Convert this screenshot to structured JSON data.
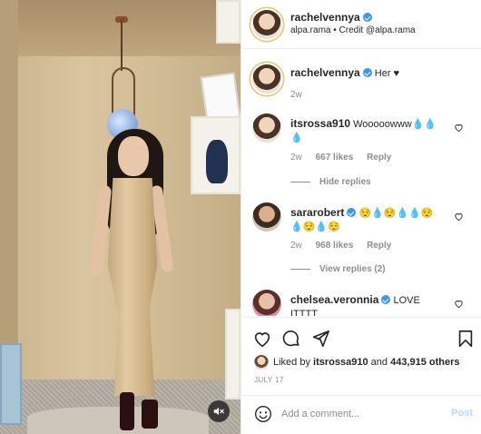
{
  "header": {
    "username": "rachelvennya",
    "verified": true,
    "subtitle": "alpa.rama • Credit @alpa.rama"
  },
  "comments": [
    {
      "username": "rachelvennya",
      "verified": true,
      "text": "Her ♥",
      "time": "2w",
      "is_caption": true
    },
    {
      "username": "itsrossa910",
      "verified": false,
      "text": "Wooooowww💧💧💧",
      "time": "2w",
      "likes": "667 likes",
      "reply_label": "Reply",
      "replies_toggle": "Hide replies"
    },
    {
      "username": "sararobert",
      "verified": true,
      "text": "😌💧😌💧💧😌💧😌💧😌",
      "time": "2w",
      "likes": "968 likes",
      "reply_label": "Reply",
      "replies_toggle": "View replies (2)"
    },
    {
      "username": "chelsea.veronnia",
      "verified": true,
      "text": "LOVE ITTTT"
    }
  ],
  "actions": {
    "icons": [
      "heart-icon",
      "comment-icon",
      "share-icon",
      "bookmark-icon"
    ],
    "liked_by_prefix": "Liked by",
    "liked_by_user": "itsrossa910",
    "liked_by_suffix": "and",
    "others_count": "443,915 others",
    "date": "JULY 17"
  },
  "composer": {
    "placeholder": "Add a comment...",
    "post_label": "Post"
  },
  "colors": {
    "accent": "#3897f0",
    "post_disabled": "#b3dbff",
    "muted": "#8e8e8e",
    "text": "#262626"
  }
}
